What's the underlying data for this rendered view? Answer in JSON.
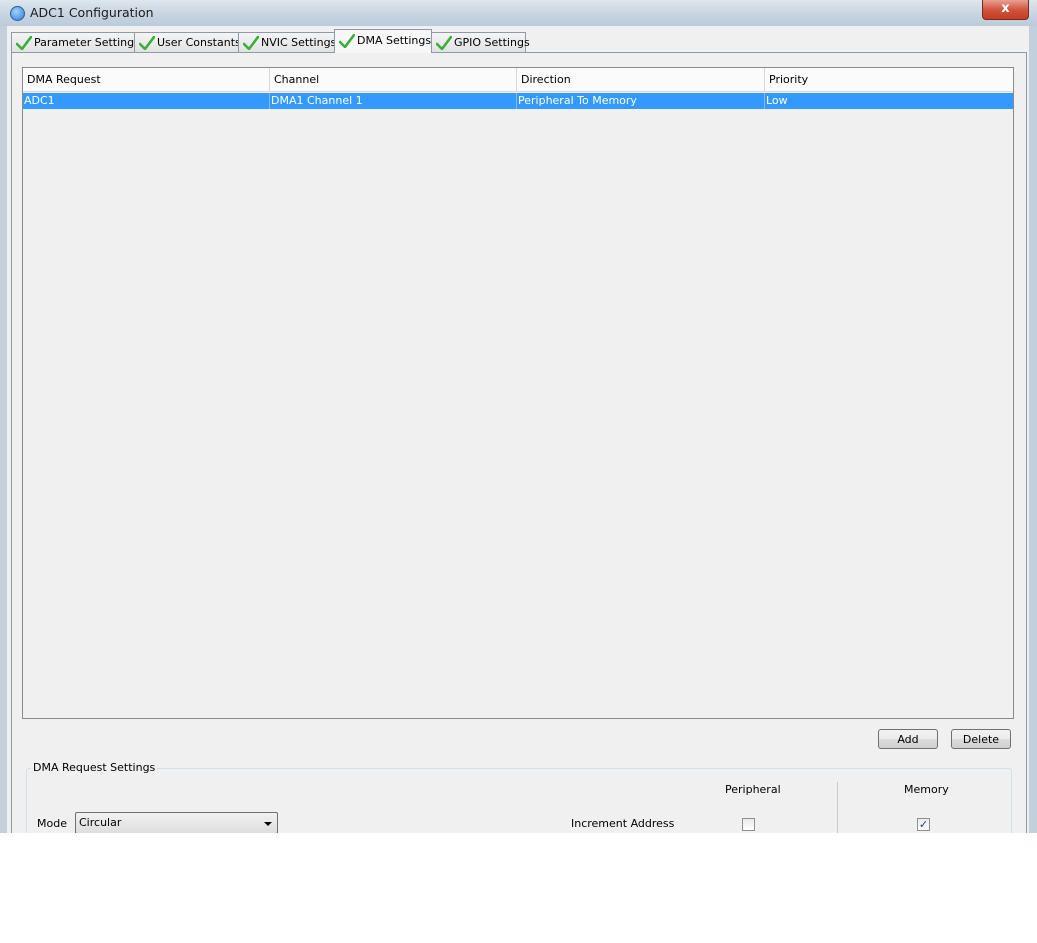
{
  "window": {
    "title": "ADC1 Configuration",
    "close_glyph": "x"
  },
  "tabs": [
    {
      "label": "Parameter Settings",
      "status_icon": "check-icon"
    },
    {
      "label": "User Constants",
      "status_icon": "check-icon"
    },
    {
      "label": "NVIC Settings",
      "status_icon": "check-icon"
    },
    {
      "label": "DMA Settings",
      "status_icon": "check-icon",
      "active": true
    },
    {
      "label": "GPIO Settings",
      "status_icon": "check-icon"
    }
  ],
  "table": {
    "columns": [
      "DMA Request",
      "Channel",
      "Direction",
      "Priority"
    ],
    "rows": [
      {
        "cells": [
          "ADC1",
          "DMA1 Channel 1",
          "Peripheral To Memory",
          "Low"
        ],
        "selected": true
      }
    ]
  },
  "actions": {
    "add_label": "Add",
    "delete_label": "Delete"
  },
  "request_settings": {
    "title": "DMA Request Settings",
    "peripheral_header": "Peripheral",
    "memory_header": "Memory",
    "mode_label": "Mode",
    "mode_value": "Circular",
    "increment_label": "Increment Address",
    "peripheral_increment": false,
    "memory_increment": true
  },
  "colors": {
    "selection": "#3399ff",
    "check": "#3cae3c"
  }
}
